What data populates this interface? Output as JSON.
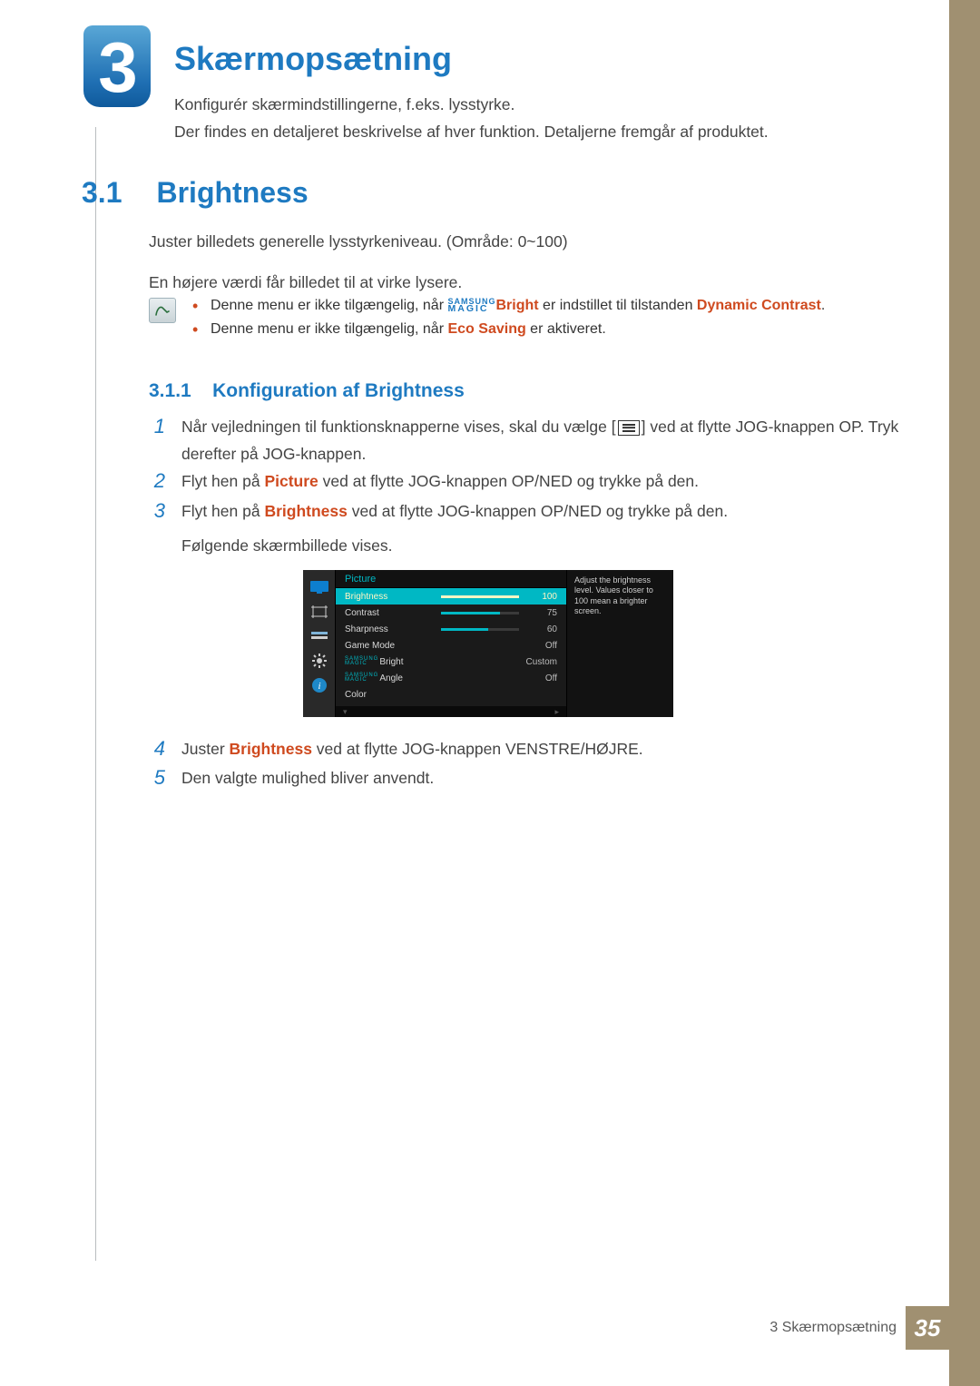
{
  "chapter": {
    "number": "3",
    "title": "Skærmopsætning"
  },
  "intro": {
    "p1": "Konfigurér skærmindstillingerne, f.eks. lysstyrke.",
    "p2": "Der findes en detaljeret beskrivelse af hver funktion. Detaljerne fremgår af produktet."
  },
  "section": {
    "number": "3.1",
    "title": "Brightness"
  },
  "body": {
    "p1": "Juster billedets generelle lysstyrkeniveau. (Område: 0~100)",
    "p2": "En højere værdi får billedet til at virke lysere."
  },
  "magic": {
    "top": "SAMSUNG",
    "bottom": "MAGIC"
  },
  "notes": {
    "n1a": "Denne menu er ikke tilgængelig, når ",
    "n1b": "Bright",
    "n1c": " er indstillet til tilstanden ",
    "n1d": "Dynamic Contrast",
    "n1e": ".",
    "n2a": "Denne menu er ikke tilgængelig, når ",
    "n2b": "Eco Saving",
    "n2c": " er aktiveret."
  },
  "subsection": {
    "number": "3.1.1",
    "title": "Konfiguration af Brightness"
  },
  "steps": {
    "s1a": "Når vejledningen til funktionsknapperne vises, skal du vælge [",
    "s1b": "] ved at flytte JOG-knappen OP. Tryk derefter på JOG-knappen.",
    "s2a": "Flyt hen på ",
    "s2b": "Picture",
    "s2c": " ved at flytte JOG-knappen OP/NED og trykke på den.",
    "s3a": "Flyt hen på ",
    "s3b": "Brightness",
    "s3c": " ved at flytte JOG-knappen OP/NED og trykke på den.",
    "s3d": "Følgende skærmbillede vises.",
    "s4a": "Juster ",
    "s4b": "Brightness",
    "s4c": " ved at flytte JOG-knappen VENSTRE/HØJRE.",
    "s5": "Den valgte mulighed bliver anvendt."
  },
  "osd": {
    "title": "Picture",
    "help": "Adjust the brightness level. Values closer to 100 mean a brighter screen.",
    "rows": [
      {
        "name": "Brightness",
        "value": "100",
        "pct": 100,
        "bar": true,
        "selected": true
      },
      {
        "name": "Contrast",
        "value": "75",
        "pct": 75,
        "bar": true
      },
      {
        "name": "Sharpness",
        "value": "60",
        "pct": 60,
        "bar": true
      },
      {
        "name": "Game Mode",
        "value": "Off"
      },
      {
        "name": "Bright",
        "value": "Custom",
        "magic": true
      },
      {
        "name": "Angle",
        "value": "Off",
        "magic": true
      },
      {
        "name": "Color",
        "value": ""
      }
    ]
  },
  "footer": {
    "chapter_label": "3 Skærmopsætning",
    "page": "35"
  }
}
